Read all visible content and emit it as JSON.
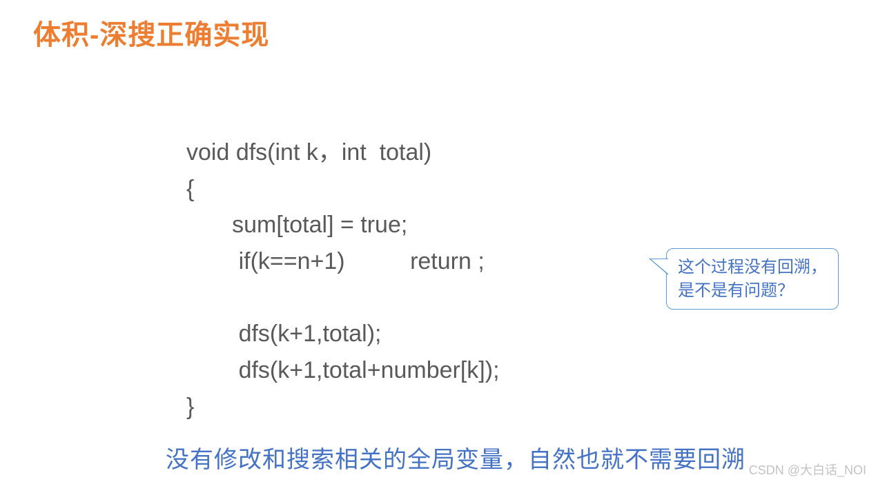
{
  "title": "体积-深搜正确实现",
  "code": {
    "line1": "void dfs(int k，int  total)",
    "line2": "{",
    "line3": "       sum[total] = true;",
    "line4": "        if(k==n+1)          return ;",
    "line5": "",
    "line6": "        dfs(k+1,total);",
    "line7": "        dfs(k+1,total+number[k]);",
    "line8": "}"
  },
  "callout": {
    "line1": "这个过程没有回溯，",
    "line2": "是不是有问题？"
  },
  "bottom_text": "没有修改和搜索相关的全局变量，自然也就不需要回溯",
  "watermark": "CSDN @大白话_NOI"
}
